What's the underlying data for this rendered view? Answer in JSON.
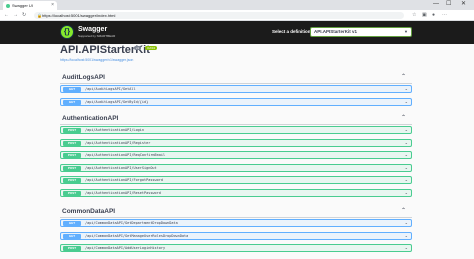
{
  "browser": {
    "tab_title": "Swagger UI",
    "url": "https://localhost:5001/swagger/index.html",
    "minimize": "—",
    "maximize": "☐",
    "close": "✕",
    "tab_close": "×"
  },
  "header": {
    "logo_name": "Swagger",
    "logo_by": "Supported by SMARTBEAR",
    "definition_label": "Select a definition",
    "definition_value": "API.APIStarterKit v1"
  },
  "info": {
    "title": "API.APIStarterKit",
    "version": "v1",
    "oas": "OAS3",
    "spec_link": "https://localhost:5001/swagger/v1/swagger.json"
  },
  "sections": [
    {
      "name": "AuditLogsAPI",
      "operations": [
        {
          "method": "GET",
          "path": "/api/AuditLogsAPI/GetAll"
        },
        {
          "method": "GET",
          "path": "/api/AuditLogsAPI/GetById/{id}"
        }
      ]
    },
    {
      "name": "AuthenticationAPI",
      "operations": [
        {
          "method": "POST",
          "path": "/api/AuthenticationAPI/Login"
        },
        {
          "method": "POST",
          "path": "/api/AuthenticationAPI/Register"
        },
        {
          "method": "POST",
          "path": "/api/AuthenticationAPI/ReqConfirmEmail"
        },
        {
          "method": "POST",
          "path": "/api/AuthenticationAPI/UserSignOut"
        },
        {
          "method": "POST",
          "path": "/api/AuthenticationAPI/ForgotPassword"
        },
        {
          "method": "POST",
          "path": "/api/AuthenticationAPI/ResetPassword"
        }
      ]
    },
    {
      "name": "CommonDataAPI",
      "operations": [
        {
          "method": "GET",
          "path": "/api/CommonDataAPI/GetDepartmentDropDownData"
        },
        {
          "method": "GET",
          "path": "/api/CommonDataAPI/GetManageUserRolesDropDownData"
        },
        {
          "method": "POST",
          "path": "/api/CommonDataAPI/AddUserLoginHistory"
        }
      ]
    }
  ],
  "colors": {
    "get": "#61affe",
    "post": "#49cc90",
    "topbar": "#1b1b1b"
  }
}
